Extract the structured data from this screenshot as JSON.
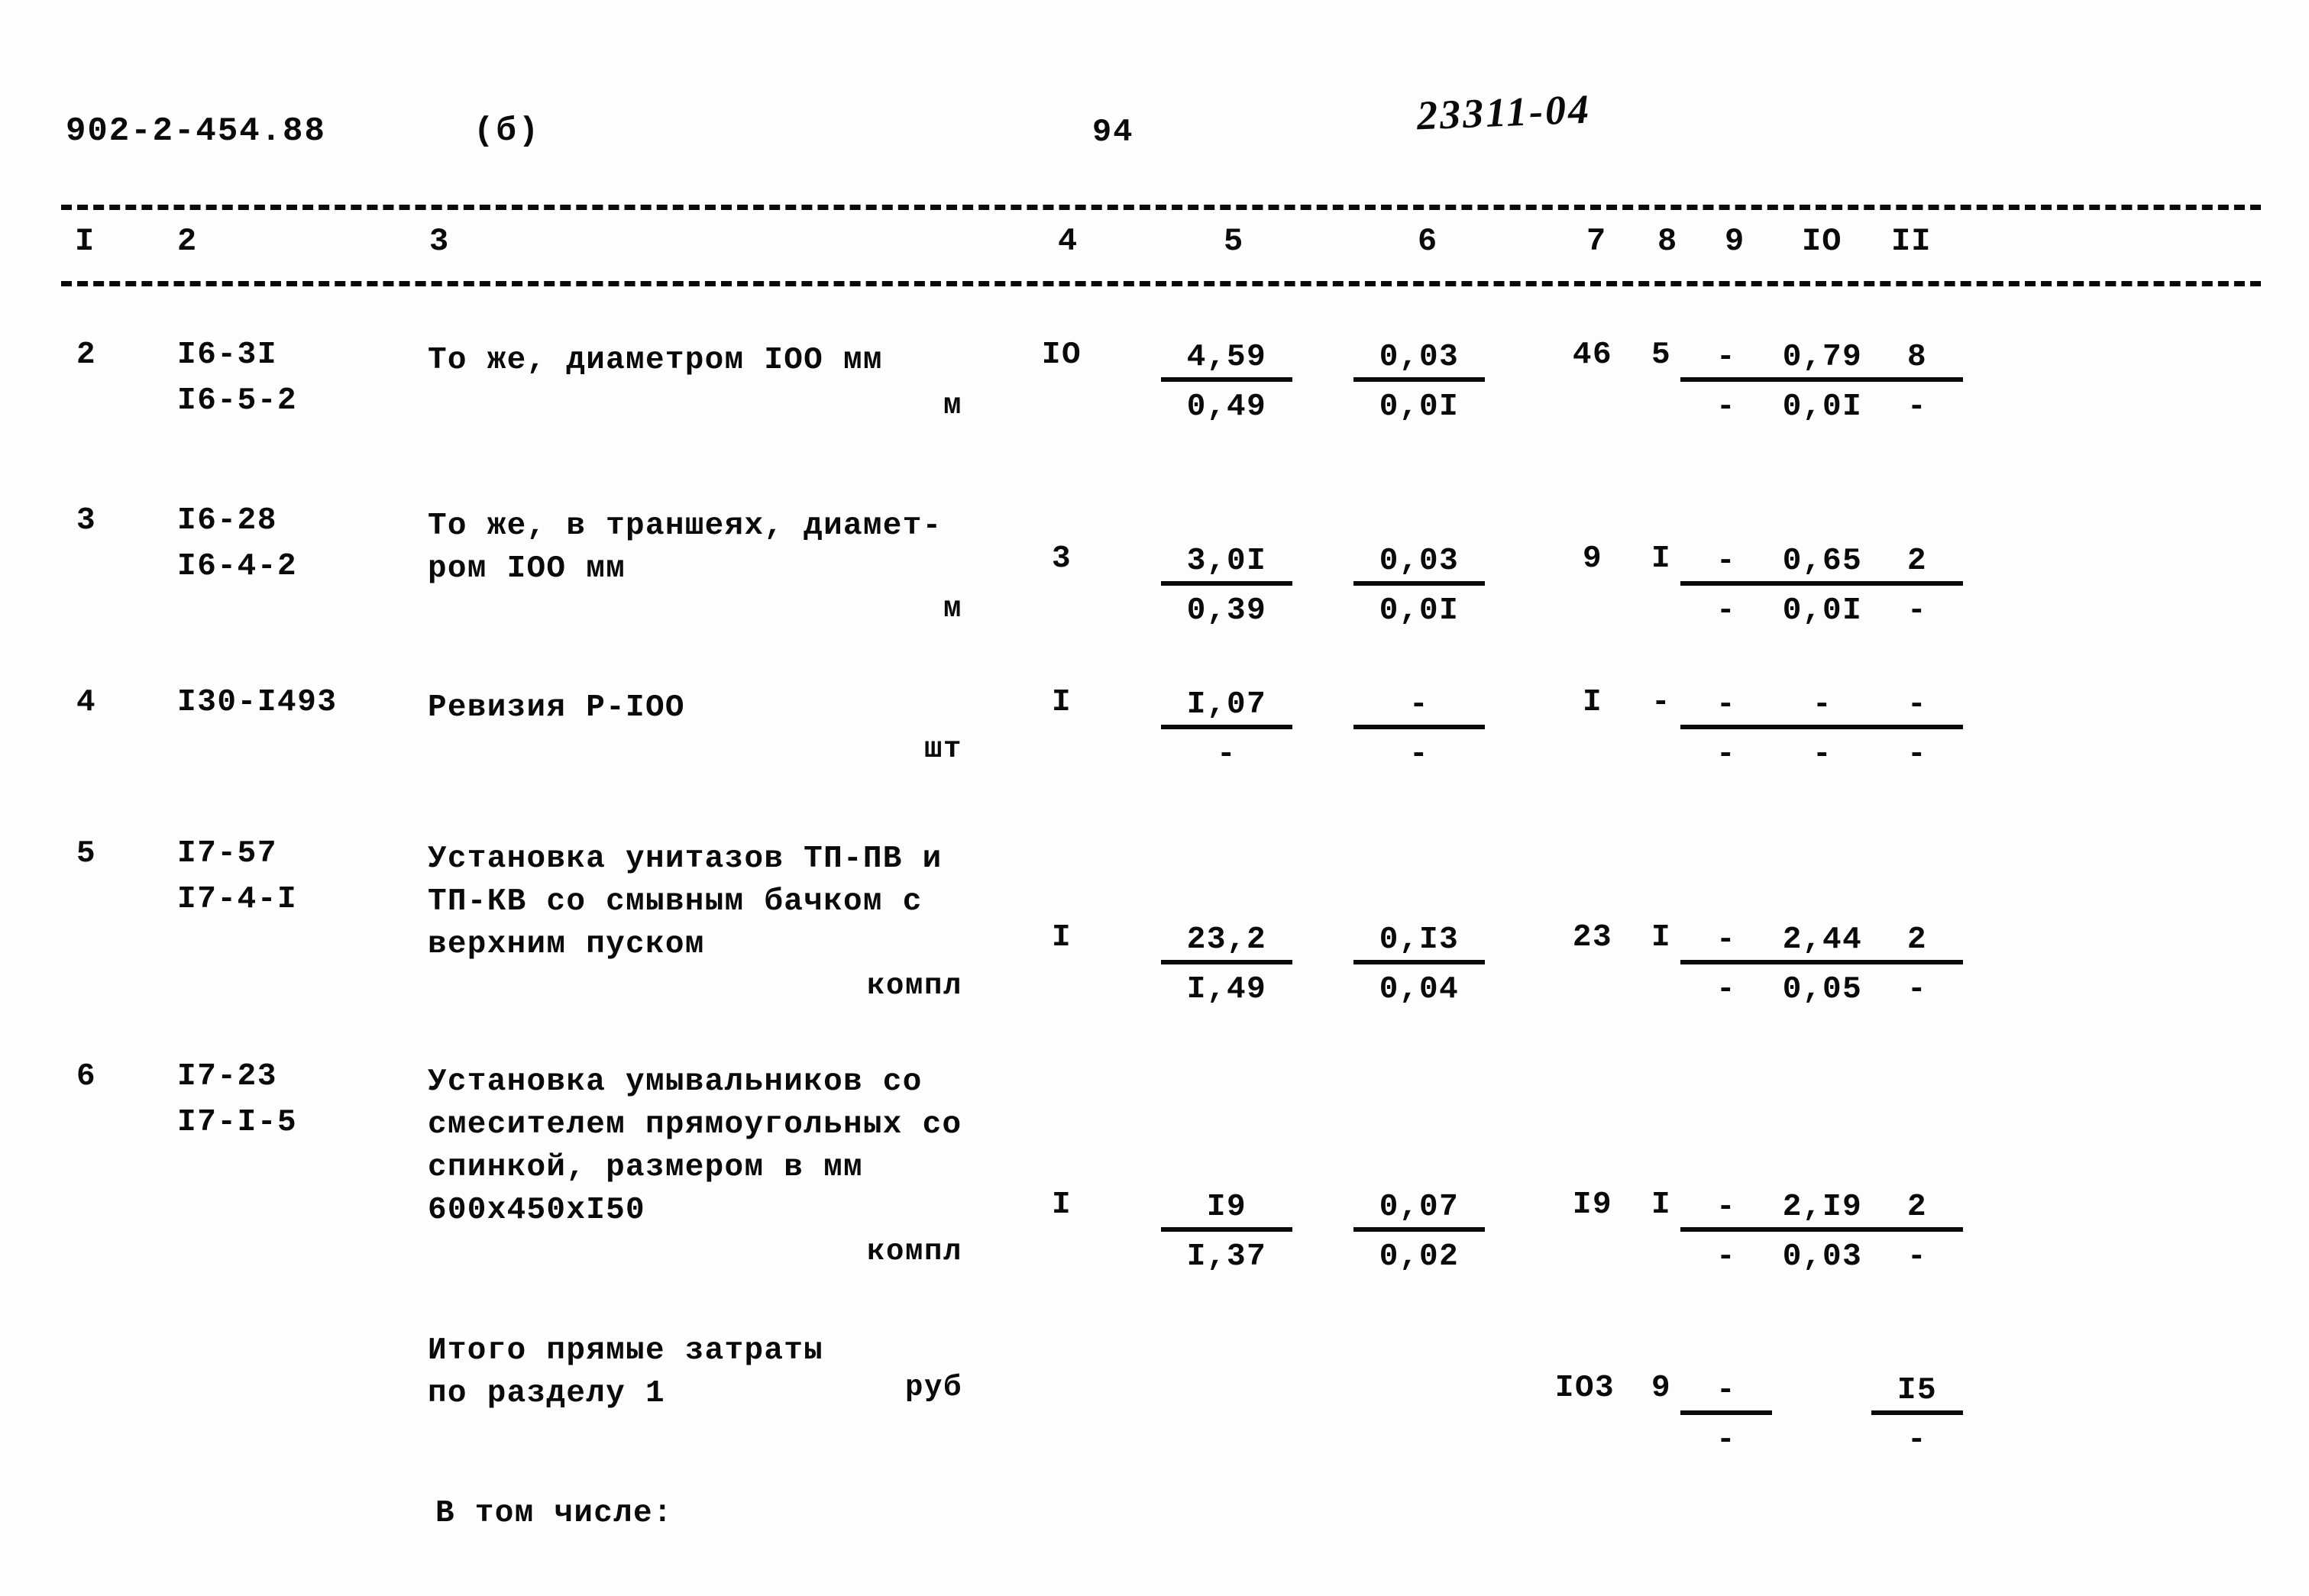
{
  "header": {
    "document_code": "902-2-454.88",
    "sheet_mark": "(б)",
    "page_number": "94",
    "handwritten_note": "23311-04"
  },
  "table": {
    "column_headers": [
      "I",
      "2",
      "3",
      "4",
      "5",
      "6",
      "7",
      "8",
      "9",
      "IO",
      "II"
    ],
    "rows": [
      {
        "index": "2",
        "codes": [
          "I6-3I",
          "I6-5-2"
        ],
        "description": [
          "То же, диаметром IOO мм"
        ],
        "unit": "м",
        "quantity": "IO",
        "c5": {
          "top": "4,59",
          "bottom": "0,49"
        },
        "c6": {
          "top": "0,03",
          "bottom": "0,0I"
        },
        "c7": "46",
        "c8": "5",
        "c9": {
          "top": "-",
          "bottom": "-"
        },
        "c10": {
          "top": "0,79",
          "bottom": "0,0I"
        },
        "c11": {
          "top": "8",
          "bottom": "-"
        }
      },
      {
        "index": "3",
        "codes": [
          "I6-28",
          "I6-4-2"
        ],
        "description": [
          "То же, в траншеях, диамет-",
          "ром IOO мм"
        ],
        "unit": "м",
        "quantity": "3",
        "c5": {
          "top": "3,0I",
          "bottom": "0,39"
        },
        "c6": {
          "top": "0,03",
          "bottom": "0,0I"
        },
        "c7": "9",
        "c8": "I",
        "c9": {
          "top": "-",
          "bottom": "-"
        },
        "c10": {
          "top": "0,65",
          "bottom": "0,0I"
        },
        "c11": {
          "top": "2",
          "bottom": "-"
        }
      },
      {
        "index": "4",
        "codes": [
          "I30-I493"
        ],
        "description": [
          "Ревизия Р-IOO"
        ],
        "unit": "шт",
        "quantity": "I",
        "c5": {
          "top": "I,07",
          "bottom": "-"
        },
        "c6": {
          "top": "-",
          "bottom": "-"
        },
        "c7": "I",
        "c8": "-",
        "c9": {
          "top": "-",
          "bottom": "-"
        },
        "c10": {
          "top": "-",
          "bottom": "-"
        },
        "c11": {
          "top": "-",
          "bottom": "-"
        }
      },
      {
        "index": "5",
        "codes": [
          "I7-57",
          "I7-4-I"
        ],
        "description": [
          "Установка унитазов ТП-ПВ и",
          "ТП-КВ со смывным бачком с",
          "верхним пуском"
        ],
        "unit": "компл",
        "quantity": "I",
        "c5": {
          "top": "23,2",
          "bottom": "I,49"
        },
        "c6": {
          "top": "0,I3",
          "bottom": "0,04"
        },
        "c7": "23",
        "c8": "I",
        "c9": {
          "top": "-",
          "bottom": "-"
        },
        "c10": {
          "top": "2,44",
          "bottom": "0,05"
        },
        "c11": {
          "top": "2",
          "bottom": "-"
        }
      },
      {
        "index": "6",
        "codes": [
          "I7-23",
          "I7-I-5"
        ],
        "description": [
          "Установка умывальников со",
          "смесителем прямоугольных со",
          "спинкой, размером в мм",
          "600х450хI50"
        ],
        "unit": "компл",
        "quantity": "I",
        "c5": {
          "top": "I9",
          "bottom": "I,37"
        },
        "c6": {
          "top": "0,07",
          "bottom": "0,02"
        },
        "c7": "I9",
        "c8": "I",
        "c9": {
          "top": "-",
          "bottom": "-"
        },
        "c10": {
          "top": "2,I9",
          "bottom": "0,03"
        },
        "c11": {
          "top": "2",
          "bottom": "-"
        }
      }
    ],
    "total_row": {
      "description": [
        "Итого прямые затраты",
        "по разделу 1"
      ],
      "unit": "руб",
      "c7": "IO3",
      "c8": "9",
      "c9": {
        "top": "-",
        "bottom": "-"
      },
      "c11": {
        "top": "I5",
        "bottom": "-"
      }
    },
    "footer_note": "В том числе:"
  }
}
